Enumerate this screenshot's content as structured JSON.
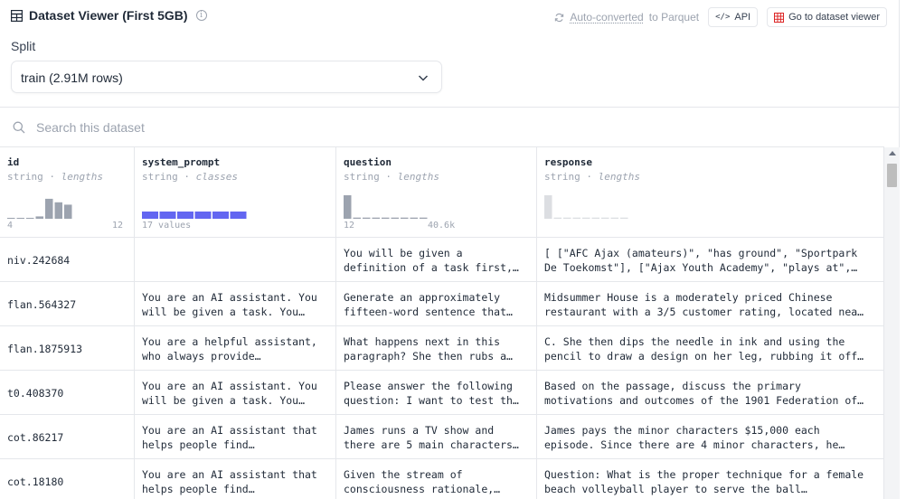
{
  "header": {
    "title": "Dataset Viewer (First 5GB)",
    "auto_converted_link": "Auto-converted",
    "auto_converted_rest": "to Parquet",
    "api_code": "</>",
    "api_label": "API",
    "go_to_viewer_label": "Go to dataset viewer"
  },
  "split": {
    "label": "Split",
    "selected": "train (2.91M rows)"
  },
  "search": {
    "placeholder": "Search this dataset"
  },
  "columns": [
    {
      "name": "id",
      "type": "string",
      "stat": "lengths",
      "min": "4",
      "max": "12"
    },
    {
      "name": "system_prompt",
      "type": "string",
      "stat": "classes",
      "summary": "17 values"
    },
    {
      "name": "question",
      "type": "string",
      "stat": "lengths",
      "min": "12",
      "max": "40.6k"
    },
    {
      "name": "response",
      "type": "string",
      "stat": "lengths"
    }
  ],
  "column_charts": {
    "id_lengths": [
      0.04,
      0.04,
      0.04,
      0.1,
      0.85,
      0.7,
      0.6
    ],
    "question_lengths": [
      1.0,
      0.05,
      0.05,
      0.05,
      0.05,
      0.05,
      0.05,
      0.05,
      0.05
    ],
    "response_lengths": [
      1.0,
      0.05,
      0.05,
      0.05,
      0.05,
      0.05,
      0.05,
      0.05,
      0.05
    ],
    "system_prompt_classes_count": 17
  },
  "colors": {
    "histogram_bar": "#9ca3af",
    "classes_bar": "#6366f1",
    "border": "#e5e7eb"
  },
  "rows": [
    {
      "id": "niv.242684",
      "system_prompt": [
        "",
        ""
      ],
      "question": [
        "You will be given a",
        "definition of a task first,…"
      ],
      "response": [
        "[ [\"AFC Ajax (amateurs)\", \"has ground\", \"Sportpark",
        "De Toekomst\"], [\"Ajax Youth Academy\", \"plays at\",…"
      ]
    },
    {
      "id": "flan.564327",
      "system_prompt": [
        "You are an AI assistant. You",
        "will be given a task. You…"
      ],
      "question": [
        "Generate an approximately",
        "fifteen-word sentence that…"
      ],
      "response": [
        "Midsummer House is a moderately priced Chinese",
        "restaurant with a 3/5 customer rating, located nea…"
      ]
    },
    {
      "id": "flan.1875913",
      "system_prompt": [
        "You are a helpful assistant,",
        "who always provide…"
      ],
      "question": [
        "What happens next in this",
        "paragraph? She then rubs a…"
      ],
      "response": [
        "C. She then dips the needle in ink and using the",
        "pencil to draw a design on her leg, rubbing it off…"
      ]
    },
    {
      "id": "t0.408370",
      "system_prompt": [
        "You are an AI assistant. You",
        "will be given a task. You…"
      ],
      "question": [
        "Please answer the following",
        "question: I want to test th…"
      ],
      "response": [
        "Based on the passage, discuss the primary",
        "motivations and outcomes of the 1901 Federation of…"
      ]
    },
    {
      "id": "cot.86217",
      "system_prompt": [
        "You are an AI assistant that",
        "helps people find…"
      ],
      "question": [
        "James runs a TV show and",
        "there are 5 main characters…"
      ],
      "response": [
        "James pays the minor characters $15,000 each",
        "episode. Since there are 4 minor characters, he…"
      ]
    },
    {
      "id": "cot.18180",
      "system_prompt": [
        "You are an AI assistant that",
        "helps people find…"
      ],
      "question": [
        "Given the stream of",
        "consciousness rationale,…"
      ],
      "response": [
        "Question: What is the proper technique for a female",
        "beach volleyball player to serve the ball…"
      ]
    }
  ]
}
